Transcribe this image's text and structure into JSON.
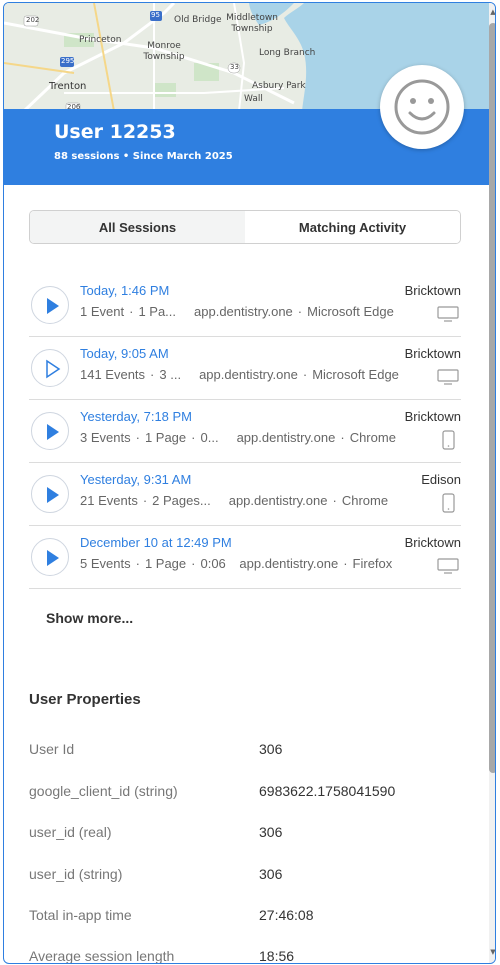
{
  "map": {
    "labels": [
      "Princeton",
      "Monroe Township",
      "Old Bridge",
      "Middletown Township",
      "Long Branch",
      "Asbury Park",
      "Trenton",
      "Wall",
      "202",
      "95",
      "295",
      "33",
      "206"
    ]
  },
  "header": {
    "title": "User 12253",
    "subtitle": "88 sessions • Since March 2025",
    "avatar_icon": "smiley-face-icon",
    "accent_color": "#2f7fe0"
  },
  "tabs": [
    {
      "label": "All Sessions",
      "active": true
    },
    {
      "label": "Matching Activity",
      "active": false
    }
  ],
  "sessions": [
    {
      "time": "Today, 1:46 PM",
      "location": "Bricktown",
      "meta": [
        "1 Event",
        "1 Pa..."
      ],
      "domain": "app.dentistry.one",
      "browser": "Microsoft Edge",
      "device": "desktop-icon",
      "play": "filled"
    },
    {
      "time": "Today, 9:05 AM",
      "location": "Bricktown",
      "meta": [
        "141 Events",
        "3 ..."
      ],
      "domain": "app.dentistry.one",
      "browser": "Microsoft Edge",
      "device": "desktop-icon",
      "play": "outline"
    },
    {
      "time": "Yesterday, 7:18 PM",
      "location": "Bricktown",
      "meta": [
        "3 Events",
        "1 Page",
        "0..."
      ],
      "domain": "app.dentistry.one",
      "browser": "Chrome",
      "device": "mobile-icon",
      "play": "filled"
    },
    {
      "time": "Yesterday, 9:31 AM",
      "location": "Edison",
      "meta": [
        "21 Events",
        "2 Pages..."
      ],
      "domain": "app.dentistry.one",
      "browser": "Chrome",
      "device": "mobile-icon",
      "play": "filled"
    },
    {
      "time": "December 10 at 12:49 PM",
      "location": "Bricktown",
      "meta": [
        "5 Events",
        "1 Page",
        "0:06"
      ],
      "domain": "app.dentistry.one",
      "browser": "Firefox",
      "device": "desktop-icon",
      "play": "filled"
    }
  ],
  "show_more": "Show more...",
  "properties": {
    "title": "User Properties",
    "rows": [
      {
        "key": "User Id",
        "value": "306"
      },
      {
        "key": "google_client_id (string)",
        "value": "6983622.1758041590"
      },
      {
        "key": "user_id (real)",
        "value": "306"
      },
      {
        "key": "user_id (string)",
        "value": "306"
      },
      {
        "key": "Total in-app time",
        "value": "27:46:08"
      },
      {
        "key": "Average session length",
        "value": "18:56"
      }
    ]
  }
}
